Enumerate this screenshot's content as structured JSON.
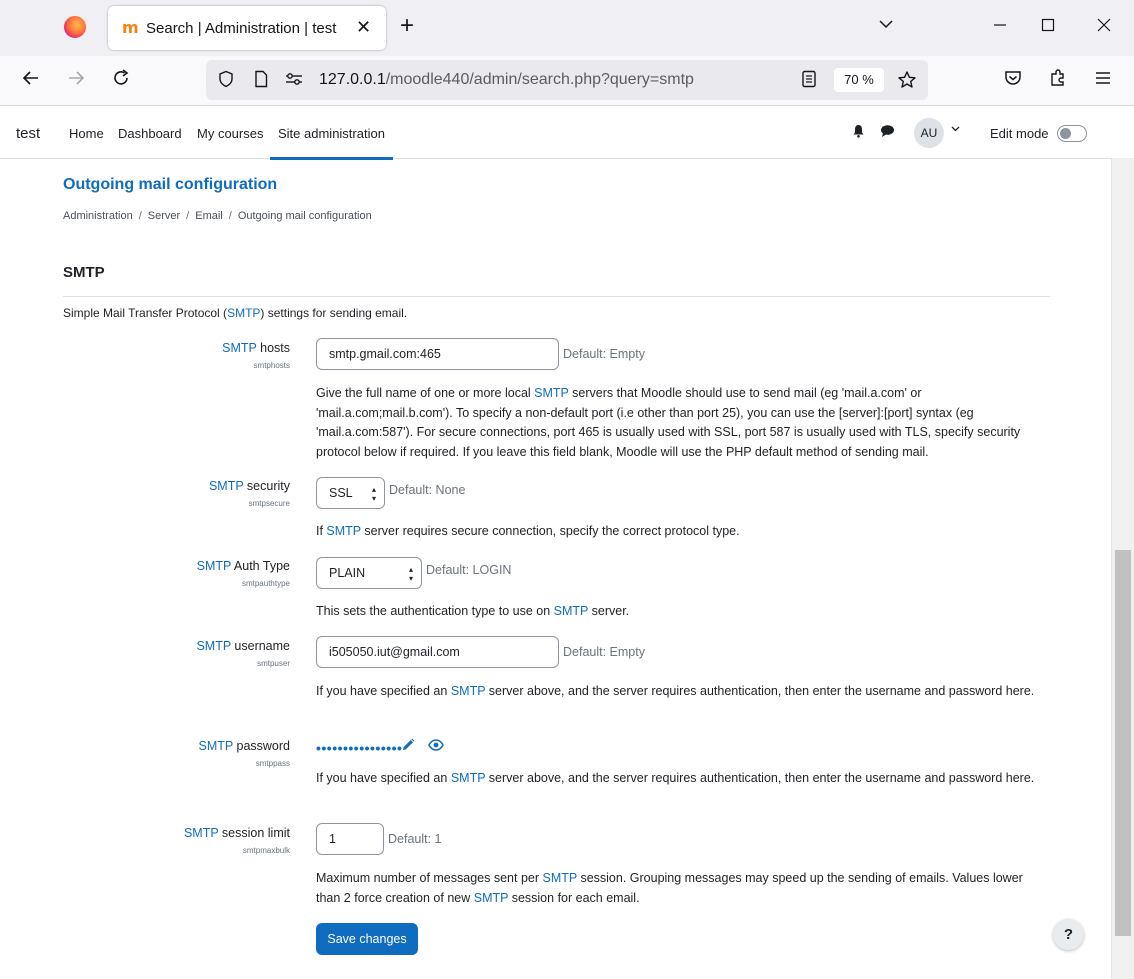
{
  "browser": {
    "tab_title": "Search | Administration | test",
    "url_host": "127.0.0.1",
    "url_path": "/moodle440/admin/search.php?query=smtp",
    "zoom": "70 %",
    "icons": [
      "firefox-logo",
      "moodle-favicon",
      "close-icon",
      "plus-icon",
      "chevron-down-icon",
      "minimize-icon",
      "maximize-icon",
      "window-close-icon",
      "back-icon",
      "forward-icon",
      "reload-icon",
      "shield-icon",
      "page-icon",
      "permissions-icon",
      "reader-view-icon",
      "star-icon",
      "pocket-icon",
      "extensions-icon",
      "menu-icon"
    ]
  },
  "moodle": {
    "site_name": "test",
    "nav": {
      "home": "Home",
      "dashboard": "Dashboard",
      "my_courses": "My courses",
      "site_admin": "Site administration"
    },
    "avatar_initials": "AU",
    "edit_mode_label": "Edit mode",
    "edit_mode_on": false,
    "accent_color": "#0f6cbf"
  },
  "page": {
    "title": "Outgoing mail configuration",
    "breadcrumb": [
      "Administration",
      "Server",
      "Email",
      "Outgoing mail configuration"
    ],
    "section_heading": "SMTP",
    "intro_before": "Simple Mail Transfer Protocol (",
    "intro_link": "SMTP",
    "intro_after": ") settings for sending email."
  },
  "settings": {
    "hosts": {
      "label_link": "SMTP",
      "label_rest": " hosts",
      "key": "smtphosts",
      "value": "smtp.gmail.com:465",
      "default": "Default: Empty",
      "desc_1": "Give the full name of one or more local ",
      "desc_link": "SMTP",
      "desc_2": " servers that Moodle should use to send mail (eg 'mail.a.com' or 'mail.a.com;mail.b.com'). To specify a non-default port (i.e other than port 25), you can use the [server]:[port] syntax (eg 'mail.a.com:587'). For secure connections, port 465 is usually used with SSL, port 587 is usually used with TLS, specify security protocol below if required. If you leave this field blank, Moodle will use the PHP default method of sending mail."
    },
    "security": {
      "label_link": "SMTP",
      "label_rest": " security",
      "key": "smtpsecure",
      "value": "SSL",
      "default": "Default: None",
      "desc_1": "If ",
      "desc_link": "SMTP",
      "desc_2": " server requires secure connection, specify the correct protocol type."
    },
    "auth_type": {
      "label_link": "SMTP",
      "label_rest": " Auth Type",
      "key": "smtpauthtype",
      "value": "PLAIN",
      "default": "Default: LOGIN",
      "desc_1": "This sets the authentication type to use on ",
      "desc_link": "SMTP",
      "desc_2": " server."
    },
    "username": {
      "label_link": "SMTP",
      "label_rest": " username",
      "key": "smtpuser",
      "value": "i505050.iut@gmail.com",
      "default": "Default: Empty",
      "desc_1": "If you have specified an ",
      "desc_link": "SMTP",
      "desc_2": " server above, and the server requires authentication, then enter the username and password here."
    },
    "password": {
      "label_link": "SMTP",
      "label_rest": " password",
      "key": "smtppass",
      "masked": "••••••••••••••••",
      "desc_1": "If you have specified an ",
      "desc_link": "SMTP",
      "desc_2": " server above, and the server requires authentication, then enter the username and password here."
    },
    "session_limit": {
      "label_link": "SMTP",
      "label_rest": " session limit",
      "key": "smtpmaxbulk",
      "value": "1",
      "default": "Default: 1",
      "desc_1": "Maximum number of messages sent per ",
      "desc_link": "SMTP",
      "desc_mid": " session. Grouping messages may speed up the sending of emails. Values lower than 2 force creation of new ",
      "desc_link2": "SMTP",
      "desc_2": " session for each email."
    }
  },
  "actions": {
    "save": "Save changes",
    "help": "?"
  }
}
